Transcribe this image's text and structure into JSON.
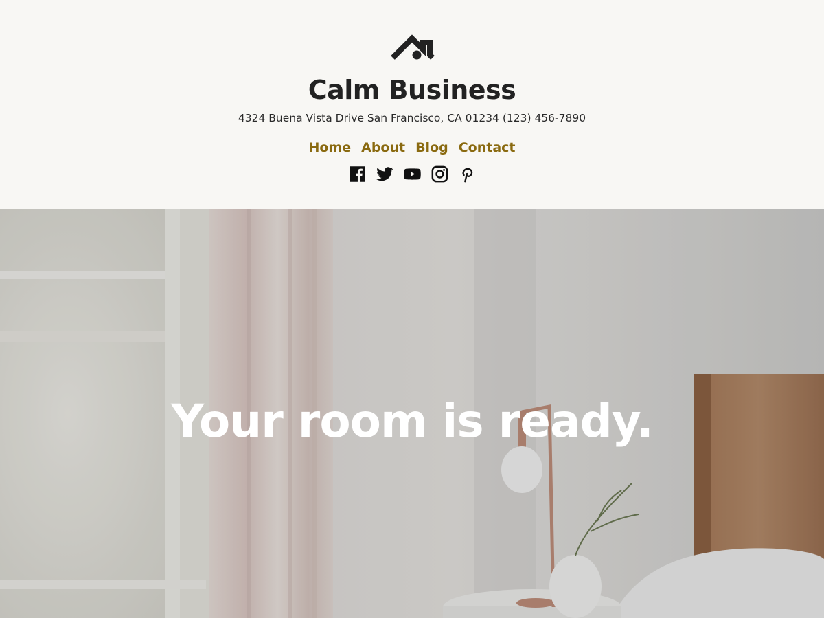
{
  "site": {
    "title": "Calm Business",
    "address": "4324 Buena Vista Drive San Francisco, CA 01234 (123) 456-7890",
    "logo_icon": "house-roof-icon"
  },
  "nav": {
    "items": [
      {
        "label": "Home"
      },
      {
        "label": "About"
      },
      {
        "label": "Blog"
      },
      {
        "label": "Contact"
      }
    ]
  },
  "social": {
    "icons": [
      "facebook-icon",
      "twitter-icon",
      "youtube-icon",
      "instagram-icon",
      "pinterest-icon"
    ]
  },
  "hero": {
    "heading": "Your room is ready.",
    "image": "bedroom-interior-image"
  },
  "colors": {
    "background": "#f8f7f4",
    "text": "#222222",
    "accent": "#8a6a10",
    "hero_text": "#ffffff"
  }
}
